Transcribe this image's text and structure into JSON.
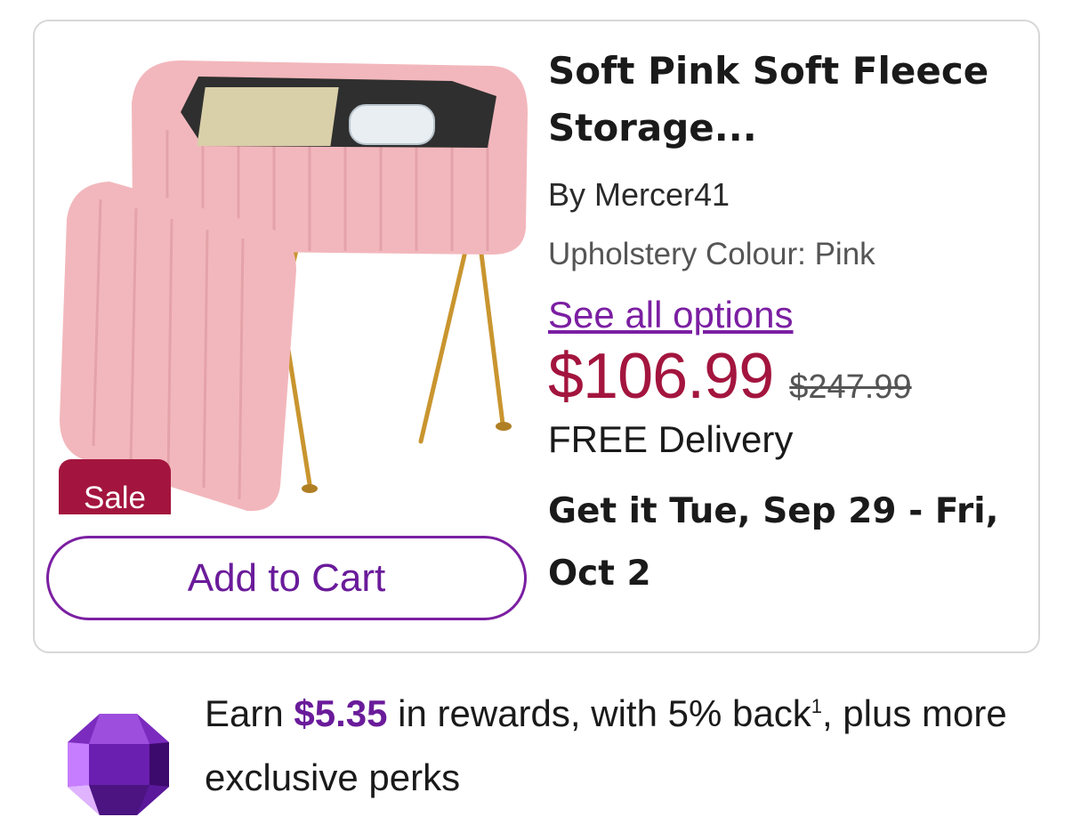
{
  "product": {
    "title": "Soft Pink Soft Fleece Storage...",
    "brand": "By Mercer41",
    "variant": "Upholstery Colour: Pink",
    "see_options_label": "See all options",
    "price": "$106.99",
    "original_price": "$247.99",
    "delivery": "FREE Delivery",
    "eta": "Get it Tue, Sep 29 - Fri, Oct 2",
    "sale_badge": "Sale",
    "add_to_cart_label": "Add to Cart",
    "image_icon": "pink-fleece-storage-stool-image"
  },
  "rewards": {
    "prefix": "Earn ",
    "amount": "$5.35",
    "middle": " in rewards, with 5% back",
    "footnote": "1",
    "suffix": ", plus more exclusive perks",
    "icon": "purple-gem-icon"
  },
  "colors": {
    "sale": "#a3153e",
    "accent": "#7b1fa2",
    "price": "#a3153e",
    "fleece_pink": "#f2b7bc",
    "gold_legs": "#c9952f"
  }
}
